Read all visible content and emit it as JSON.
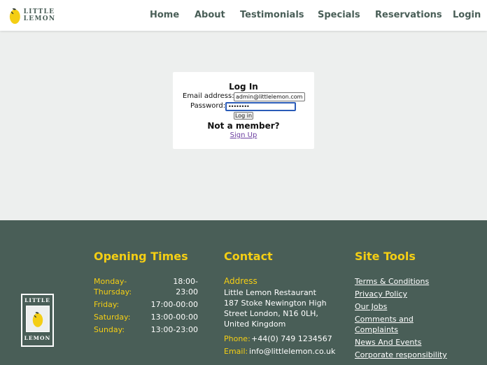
{
  "header": {
    "logo_text": "LITTLE LEMON",
    "nav": [
      "Home",
      "About",
      "Testimonials",
      "Specials",
      "Reservations",
      "Login"
    ]
  },
  "login": {
    "title": "Log In",
    "email_label": "Email address:",
    "email_value": "admin@littlelemon.com",
    "password_label": "Password:",
    "password_value": "••••••••",
    "button_label": "Log in",
    "not_member": "Not a member?",
    "signup_link": "Sign Up"
  },
  "footer": {
    "logo_top": "LITTLE",
    "logo_bottom": "LEMON",
    "opening": {
      "title": "Opening Times",
      "rows": [
        {
          "day": "Monday-\nThursday:",
          "hours": "18:00-\n23:00"
        },
        {
          "day": "Friday:",
          "hours": "17:00-00:00"
        },
        {
          "day": "Saturday:",
          "hours": "13:00-00:00"
        },
        {
          "day": "Sunday:",
          "hours": "13:00-23:00"
        }
      ]
    },
    "contact": {
      "title": "Contact",
      "address_label": "Address",
      "address_lines": [
        "Little Lemon Restaurant",
        "187 Stoke Newington High",
        "Street London, N16 0LH,",
        "United Kingdom"
      ],
      "phone_label": "Phone:",
      "phone_value": "+44(0) 749 1234567",
      "email_label": "Email:",
      "email_value": "info@littlelemon.co.uk"
    },
    "site_tools": {
      "title": "Site Tools",
      "links": [
        "Terms & Conditions",
        "Privacy Policy",
        "Our Jobs",
        "Comments and\nComplaints",
        "News And Events",
        "Corporate responsibility"
      ]
    }
  },
  "colors": {
    "primary_green": "#495e57",
    "primary_yellow": "#f4ce14",
    "background": "#edefee"
  }
}
